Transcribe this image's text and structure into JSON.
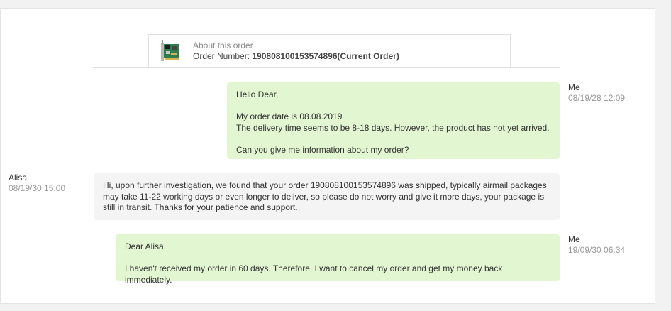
{
  "order": {
    "about_label": "About this order",
    "number_label": "Order Number:",
    "number_value": "190808100153574896(Current Order)"
  },
  "messages": [
    {
      "sender": "Me",
      "time": "08/19/28 12:09",
      "side": "right",
      "text": "Hello Dear,\n\nMy order date is 08.08.2019\nThe delivery time seems to be 8-18 days. However, the product has not yet arrived.\n\nCan you give me information about my order?"
    },
    {
      "sender": "Alisa",
      "time": "08/19/30 15:00",
      "side": "left",
      "text": "Hi, upon further investigation, we found that your order 190808100153574896 was shipped, typically airmail packages may take 11-22 working days or even longer to deliver, so please do not worry and give it more days, your package is still in transit. Thanks for your patience and support."
    },
    {
      "sender": "Me",
      "time": "19/09/30 06:34",
      "side": "right",
      "text": "Dear Alisa,\n\nI haven't received my order in 60 days. Therefore, I want to cancel my order and get my money back immediately."
    }
  ],
  "colors": {
    "mine_bubble": "#e3f6d2",
    "their_bubble": "#f4f4f4"
  },
  "icons": {
    "product_thumbnail": "pcie-card-image"
  }
}
